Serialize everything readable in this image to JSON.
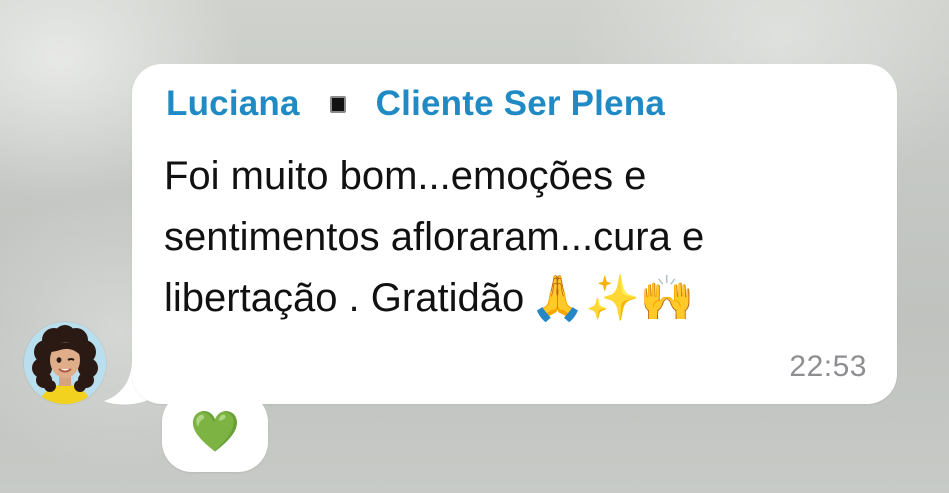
{
  "message": {
    "sender_name": "Luciana",
    "separator_icon": "black-square-icon",
    "sender_title": "Cliente Ser Plena",
    "text": "Foi muito bom...emoções e\nsentimentos afloraram...cura e\nlibertação . Gratidão",
    "emojis": [
      "🙏",
      "✨",
      "🙌"
    ],
    "time": "22:53"
  },
  "reaction": {
    "emoji": "💚"
  },
  "colors": {
    "sender": "#1f8ac3",
    "bubble": "#ffffff",
    "text": "#111111",
    "timestamp": "#8e8e93"
  }
}
